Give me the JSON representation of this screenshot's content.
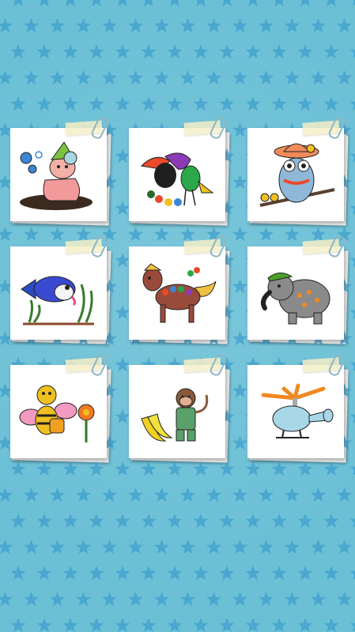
{
  "screen": {
    "background_color": "#6cc0d6",
    "star_color": "#3f9fcc"
  },
  "gallery": {
    "items": [
      {
        "name": "frog-with-bubbles"
      },
      {
        "name": "toucan-and-parrot"
      },
      {
        "name": "owl-with-hat"
      },
      {
        "name": "fish-in-seaweed"
      },
      {
        "name": "horse-with-flowers"
      },
      {
        "name": "elephant-with-cap"
      },
      {
        "name": "bee-with-honey-pot"
      },
      {
        "name": "monkey-with-bananas"
      },
      {
        "name": "helicopter"
      }
    ]
  }
}
